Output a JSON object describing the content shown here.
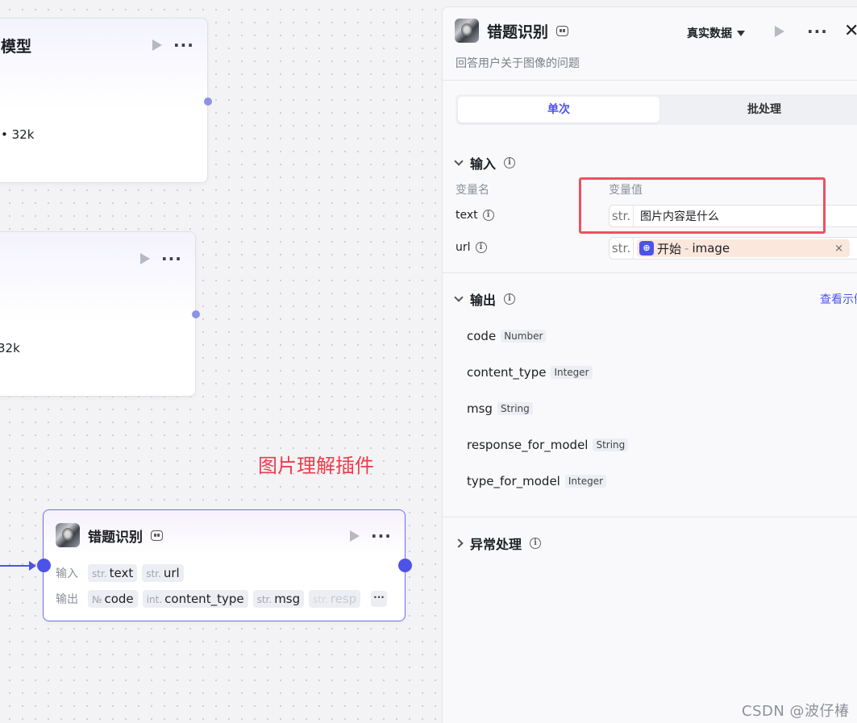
{
  "canvas": {
    "node_top": {
      "title_fragment": "模型",
      "meta": "• 32k"
    },
    "node_mid": {
      "meta": "32k"
    },
    "annotation": "图片理解插件",
    "main_node": {
      "title": "错题识别",
      "input_label": "输入",
      "output_label": "输出",
      "inputs": [
        {
          "type": "str.",
          "name": "text"
        },
        {
          "type": "str.",
          "name": "url"
        }
      ],
      "outputs": [
        {
          "type": "№",
          "name": "code"
        },
        {
          "type": "int.",
          "name": "content_type"
        },
        {
          "type": "str.",
          "name": "msg"
        },
        {
          "type": "str.",
          "name": "resp"
        }
      ],
      "more_label": "···"
    }
  },
  "panel": {
    "title": "错题识别",
    "description": "回答用户关于图像的问题",
    "data_select": "真实数据",
    "close_label": "✕",
    "tabs": [
      {
        "label": "单次"
      },
      {
        "label": "批处理"
      }
    ],
    "input_section": {
      "title": "输入",
      "col_name": "变量名",
      "col_value": "变量值",
      "rows": [
        {
          "name": "text",
          "type": "str.",
          "value": "图片内容是什么"
        },
        {
          "name": "url",
          "type": "str.",
          "ref_source": "开始",
          "ref_sep": "-",
          "ref_field": "image",
          "clear": "×"
        }
      ]
    },
    "output_section": {
      "title": "输出",
      "view_link": "查看示例",
      "fields": [
        {
          "name": "code",
          "type": "Number"
        },
        {
          "name": "content_type",
          "type": "Integer"
        },
        {
          "name": "msg",
          "type": "String"
        },
        {
          "name": "response_for_model",
          "type": "String"
        },
        {
          "name": "type_for_model",
          "type": "Integer"
        }
      ]
    },
    "error_section": {
      "title": "异常处理"
    }
  },
  "watermark": "CSDN @波仔椿",
  "colors": {
    "accent": "#4d53e8",
    "annotation_red": "#ef3a4a",
    "ref_chip_bg": "#fbe7dc"
  }
}
